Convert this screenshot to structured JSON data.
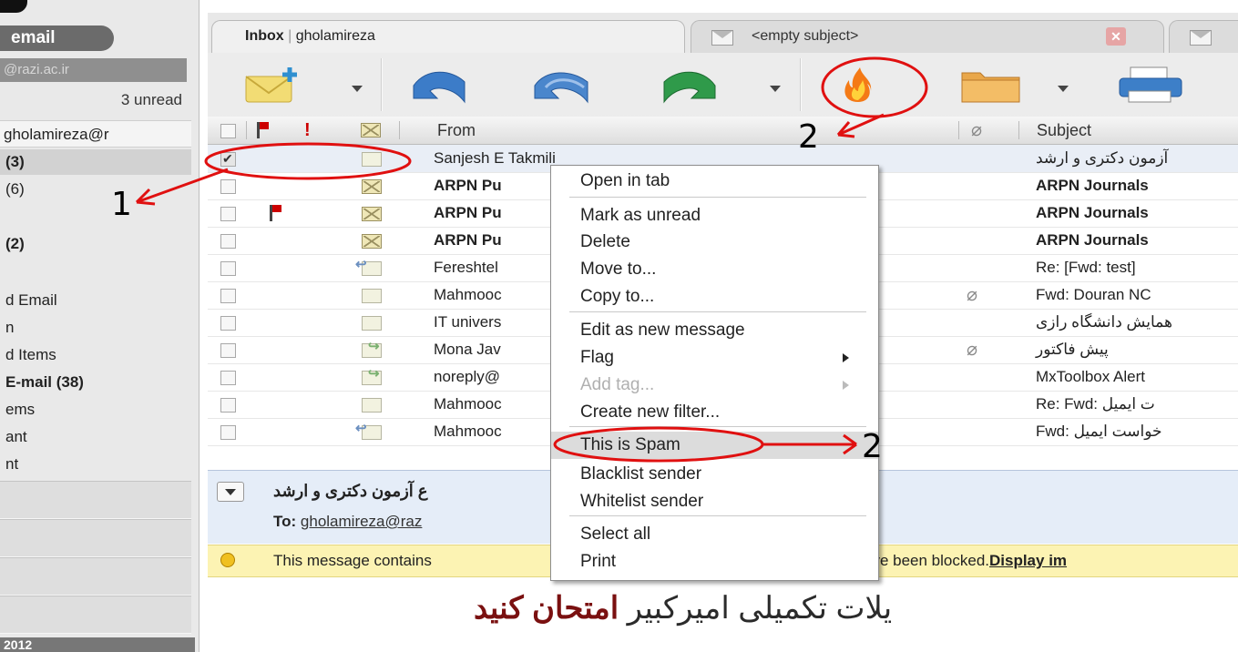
{
  "sidebar": {
    "email_pill": "email",
    "address": "@razi.ac.ir",
    "unread": "3 unread",
    "account": "gholamireza@r",
    "folders": [
      {
        "label": "(3)"
      },
      {
        "label": "(6)"
      },
      {
        "label": ""
      },
      {
        "label": "(2)"
      },
      {
        "label": ""
      },
      {
        "label": "d Email"
      },
      {
        "label": "n"
      },
      {
        "label": "d Items"
      },
      {
        "label": "E-mail (38)"
      },
      {
        "label": "ems"
      },
      {
        "label": "ant"
      },
      {
        "label": "nt"
      }
    ],
    "calendar": "2012"
  },
  "tabs": [
    {
      "label": "Inbox",
      "sub": "gholamireza"
    },
    {
      "label": "<empty subject>"
    }
  ],
  "toolbar": {
    "buttons": [
      "new-message",
      "reply",
      "reply-all",
      "forward",
      "spam",
      "move-to-folder",
      "print"
    ]
  },
  "list": {
    "headers": {
      "from": "From",
      "subject": "Subject"
    },
    "rows": [
      {
        "from": "Sanjesh E Takmili",
        "subject": "آزمون دکتری و ارشد",
        "checked": true,
        "unread": false,
        "flag": false,
        "clip": false,
        "icon": "read"
      },
      {
        "from": "ARPN Pu",
        "subject": "ARPN Journals",
        "checked": false,
        "unread": true,
        "flag": false,
        "clip": false,
        "icon": "new"
      },
      {
        "from": "ARPN Pu",
        "subject": "ARPN Journals",
        "checked": false,
        "unread": true,
        "flag": true,
        "clip": false,
        "icon": "new"
      },
      {
        "from": "ARPN Pu",
        "subject": "ARPN Journals",
        "checked": false,
        "unread": true,
        "flag": false,
        "clip": false,
        "icon": "new"
      },
      {
        "from": "Fereshtel",
        "subject": "Re: [Fwd: test]",
        "checked": false,
        "unread": false,
        "flag": false,
        "clip": false,
        "icon": "reply"
      },
      {
        "from": "Mahmooc",
        "subject": "Fwd: Douran NC",
        "checked": false,
        "unread": false,
        "flag": false,
        "clip": true,
        "icon": "read"
      },
      {
        "from": "IT univers",
        "subject": "همایش دانشگاه رازی",
        "checked": false,
        "unread": false,
        "flag": false,
        "clip": false,
        "icon": "read"
      },
      {
        "from": "Mona Jav",
        "subject": "پیش فاکتور",
        "checked": false,
        "unread": false,
        "flag": false,
        "clip": true,
        "icon": "fwd"
      },
      {
        "from": "noreply@",
        "subject": "MxToolbox Alert",
        "checked": false,
        "unread": false,
        "flag": false,
        "clip": false,
        "icon": "fwd"
      },
      {
        "from": "Mahmooc",
        "subject": "Re: Fwd: ت ایمیل",
        "checked": false,
        "unread": false,
        "flag": false,
        "clip": false,
        "icon": "read"
      },
      {
        "from": "Mahmooc",
        "subject": "Fwd: خواست ایمیل",
        "checked": false,
        "unread": false,
        "flag": false,
        "clip": false,
        "icon": "reply"
      }
    ]
  },
  "preview": {
    "subject": "ع آزمون دکتری و ارشد",
    "to_label": "To:",
    "to_value": "gholamireza@raz",
    "notice_prefix": "This message contains",
    "notice_suffix": "ave been blocked.",
    "notice_link": "Display im",
    "body_dark": "یلات تکمیلی امیرکبیر",
    "body_red": "امتحان کنید"
  },
  "context_menu": {
    "items": [
      {
        "label": "Open in tab",
        "disabled": false,
        "submenu": false,
        "highlight": false
      },
      {
        "label": "Mark as unread",
        "disabled": false,
        "submenu": false,
        "highlight": false
      },
      {
        "label": "Delete",
        "disabled": false,
        "submenu": false,
        "highlight": false
      },
      {
        "label": "Move to...",
        "disabled": false,
        "submenu": false,
        "highlight": false
      },
      {
        "label": "Copy to...",
        "disabled": false,
        "submenu": false,
        "highlight": false
      },
      {
        "label": "Edit as new message",
        "disabled": false,
        "submenu": false,
        "highlight": false
      },
      {
        "label": "Flag",
        "disabled": false,
        "submenu": true,
        "highlight": false
      },
      {
        "label": "Add tag...",
        "disabled": true,
        "submenu": true,
        "highlight": false
      },
      {
        "label": "Create new filter...",
        "disabled": false,
        "submenu": false,
        "highlight": false
      },
      {
        "label": "This is Spam",
        "disabled": false,
        "submenu": false,
        "highlight": true
      },
      {
        "label": "Blacklist sender",
        "disabled": false,
        "submenu": false,
        "highlight": false
      },
      {
        "label": "Whitelist sender",
        "disabled": false,
        "submenu": false,
        "highlight": false
      },
      {
        "label": "Select all",
        "disabled": false,
        "submenu": false,
        "highlight": false
      },
      {
        "label": "Print",
        "disabled": false,
        "submenu": false,
        "highlight": false
      }
    ]
  },
  "annotations": {
    "step1": "1",
    "step2_toolbar": "2",
    "step2_menu": "2",
    "color": "#e01010"
  }
}
